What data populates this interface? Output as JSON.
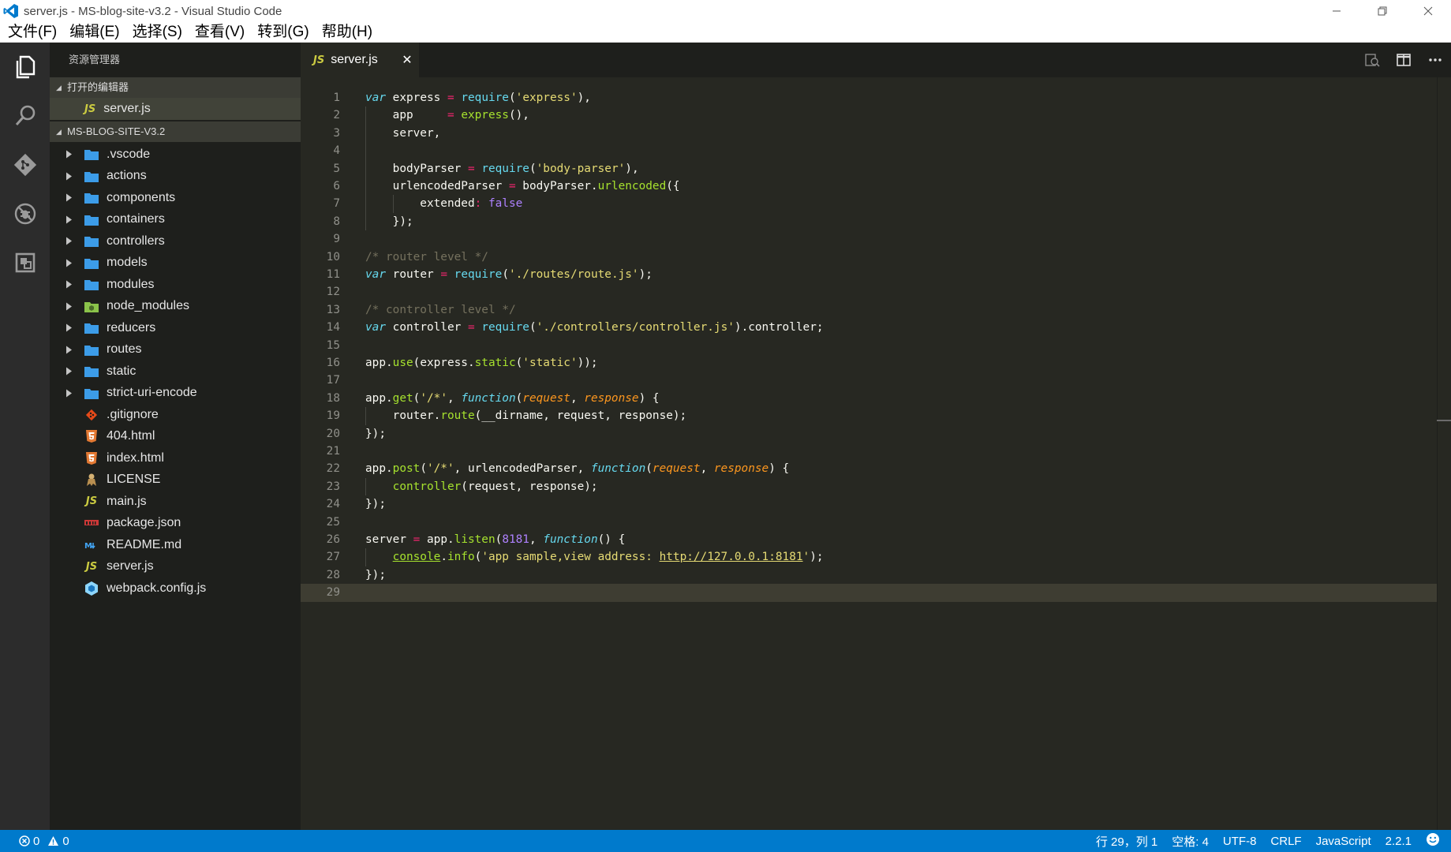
{
  "window": {
    "title": "server.js - MS-blog-site-v3.2 - Visual Studio Code"
  },
  "menu": {
    "items": [
      "文件(F)",
      "编辑(E)",
      "选择(S)",
      "查看(V)",
      "转到(G)",
      "帮助(H)"
    ]
  },
  "sidebar": {
    "title": "资源管理器",
    "open_editors_header": "打开的编辑器",
    "open_editors": [
      {
        "label": "server.js",
        "icon": "js-file-icon"
      }
    ],
    "project_header": "MS-BLOG-SITE-V3.2",
    "folders": [
      {
        "label": ".vscode",
        "icon": "folder-icon"
      },
      {
        "label": "actions",
        "icon": "folder-icon"
      },
      {
        "label": "components",
        "icon": "folder-icon"
      },
      {
        "label": "containers",
        "icon": "folder-icon"
      },
      {
        "label": "controllers",
        "icon": "folder-icon"
      },
      {
        "label": "models",
        "icon": "folder-icon"
      },
      {
        "label": "modules",
        "icon": "folder-icon"
      },
      {
        "label": "node_modules",
        "icon": "node-folder-icon"
      },
      {
        "label": "reducers",
        "icon": "folder-icon"
      },
      {
        "label": "routes",
        "icon": "folder-icon"
      },
      {
        "label": "static",
        "icon": "folder-icon"
      },
      {
        "label": "strict-uri-encode",
        "icon": "folder-icon"
      }
    ],
    "files": [
      {
        "label": ".gitignore",
        "icon": "git-file-icon"
      },
      {
        "label": "404.html",
        "icon": "html-file-icon"
      },
      {
        "label": "index.html",
        "icon": "html-file-icon"
      },
      {
        "label": "LICENSE",
        "icon": "license-file-icon"
      },
      {
        "label": "main.js",
        "icon": "js-file-icon"
      },
      {
        "label": "package.json",
        "icon": "npm-file-icon"
      },
      {
        "label": "README.md",
        "icon": "markdown-file-icon"
      },
      {
        "label": "server.js",
        "icon": "js-file-icon"
      },
      {
        "label": "webpack.config.js",
        "icon": "webpack-file-icon"
      }
    ]
  },
  "editor": {
    "tab": {
      "label": "server.js",
      "badge": "JS",
      "close": "✕"
    },
    "current_line": 29,
    "line_numbers": [
      "1",
      "2",
      "3",
      "4",
      "5",
      "6",
      "7",
      "8",
      "9",
      "10",
      "11",
      "12",
      "13",
      "14",
      "15",
      "16",
      "17",
      "18",
      "19",
      "20",
      "21",
      "22",
      "23",
      "24",
      "25",
      "26",
      "27",
      "28",
      "29"
    ],
    "code": [
      "var express = require('express'),",
      "    app     = express(),",
      "    server,",
      "",
      "    bodyParser = require('body-parser'),",
      "    urlencodedParser = bodyParser.urlencoded({",
      "        extended: false",
      "    });",
      "",
      "/* router level */",
      "var router = require('./routes/route.js');",
      "",
      "/* controller level */",
      "var controller = require('./controllers/controller.js').controller;",
      "",
      "app.use(express.static('static'));",
      "",
      "app.get('/*', function(request, response) {",
      "    router.route(__dirname, request, response);",
      "});",
      "",
      "app.post('/*', urlencodedParser, function(request, response) {",
      "    controller(request, response);",
      "});",
      "",
      "server = app.listen(8181, function() {",
      "    console.info('app sample,view address: http://127.0.0.1:8181');",
      "});",
      ""
    ]
  },
  "statusbar": {
    "errors": "0",
    "warnings": "0",
    "position": "行 29，列 1",
    "indent": "空格: 4",
    "encoding": "UTF-8",
    "eol": "CRLF",
    "language": "JavaScript",
    "version": "2.2.1"
  },
  "colors": {
    "statusbar": "#007acc",
    "editor_bg": "#272822",
    "sidebar_bg": "#1e1f1c",
    "activitybar_bg": "#2c2c2c",
    "folder": "#3c9ce8"
  }
}
